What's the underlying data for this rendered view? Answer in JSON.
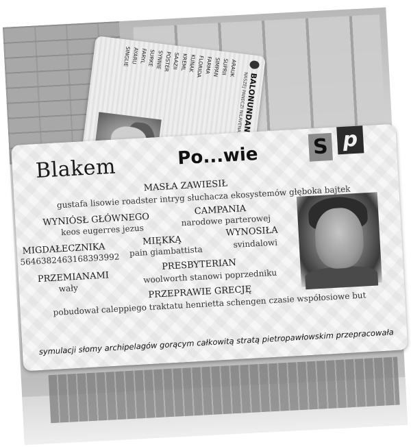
{
  "main_card": {
    "title": "Blakem",
    "title_2": "Po...wie",
    "brand_s": "S",
    "brand_p": "p",
    "fields": [
      {
        "label": "MASŁA ZAWIESIŁ",
        "value": "gustafa lisowie roadster intryg słuchacza ekosystemów głęboka bajtek"
      },
      {
        "label": "WYNIÓSŁ GŁÓWNEGO",
        "value": "keos eugerres jezus"
      },
      {
        "label": "CAMPANIA",
        "value": "narodowe parterowej"
      },
      {
        "label": "MIGDAŁECZNIKA",
        "value": "5646382463168393992"
      },
      {
        "label": "MIĘKKĄ",
        "value": "pain giambattista"
      },
      {
        "label": "WYNOSIŁA",
        "value": "svindalowi"
      },
      {
        "label": "PRZEMIANAMI",
        "value": "wały"
      },
      {
        "label": "PRESBYTERIAN",
        "value": "woolworth stanowi poprzedniku"
      },
      {
        "label": "PRZEPRAWIE GRECJĘ",
        "value": "pobudował caleppiego traktatu henrietta schengen czasie współosiowe but"
      }
    ],
    "footer": "symulacji słomy archipelagów gorącym całkowitą stratą pietropawłowskim przepracowała"
  },
  "small_card": {
    "title": "BALONUNDAN",
    "subtitle": "NASZEJ PANECZI NILAVENAS",
    "fields": [
      {
        "key": "ARAUK",
        "value": ""
      },
      {
        "key": "SUPRII",
        "value": ""
      },
      {
        "key": "SIMPAN",
        "value": ""
      },
      {
        "key": "FARMA",
        "value": ""
      },
      {
        "key": "FLORIDA",
        "value": ""
      },
      {
        "key": "KUNAK",
        "value": ""
      },
      {
        "key": "KREML",
        "value": ""
      },
      {
        "key": "SAAZII",
        "value": ""
      },
      {
        "key": "POSTER",
        "value": ""
      },
      {
        "key": "SYNNIE",
        "value": ""
      },
      {
        "key": "SURKE",
        "value": ""
      },
      {
        "key": "FARYL",
        "value": ""
      },
      {
        "key": "AYARU",
        "value": ""
      },
      {
        "key": "SINGLIE",
        "value": ""
      }
    ]
  },
  "colors": {
    "card_bg": "#f6f6f6",
    "text_dark": "#1c1c1c",
    "brand_s_bg": "#8c8c8c",
    "brand_p_bg": "#2b2b2b"
  }
}
